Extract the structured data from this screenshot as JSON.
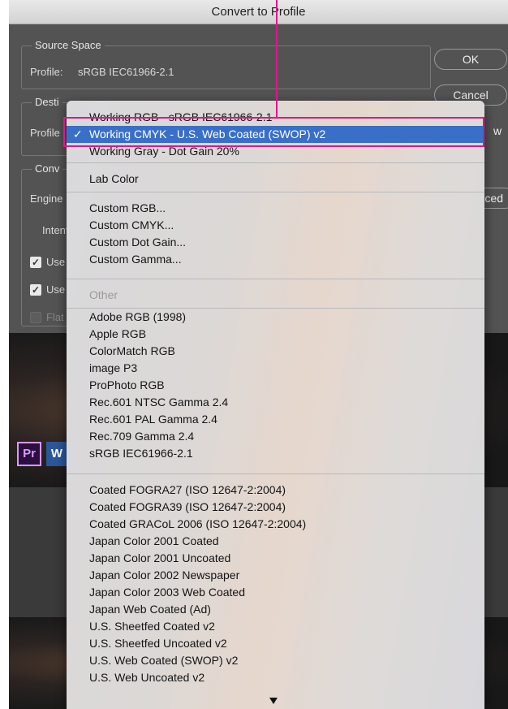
{
  "dialog": {
    "title": "Convert to Profile",
    "source": {
      "title": "Source Space",
      "profile_label": "Profile:",
      "profile_value": "sRGB IEC61966-2.1"
    },
    "destination": {
      "title": "Desti",
      "profile_label": "Profile"
    },
    "conversion": {
      "title": "Conv",
      "engine_label": "Engine",
      "intent_label": "Intent",
      "check1_label": "Use",
      "check2_label": "Use",
      "check3_label": "Flat",
      "check1_checked": true,
      "check2_checked": true,
      "check3_checked": false
    },
    "buttons": {
      "ok": "OK",
      "cancel": "Cancel",
      "preview_fragment": "w",
      "advanced_fragment": "ced"
    }
  },
  "background_apps": {
    "pr": "Pr",
    "w": "W"
  },
  "menu": {
    "selected_index": 1,
    "groups": [
      [
        "Working RGB - sRGB IEC61966-2.1",
        "Working CMYK - U.S. Web Coated (SWOP) v2",
        "Working Gray - Dot Gain 20%"
      ],
      [
        "Lab Color"
      ],
      [
        "Custom RGB...",
        "Custom CMYK...",
        "Custom Dot Gain...",
        "Custom Gamma..."
      ],
      [
        "Other"
      ],
      [
        "Adobe RGB (1998)",
        "Apple RGB",
        "ColorMatch RGB",
        "image P3",
        "ProPhoto RGB",
        "Rec.601 NTSC Gamma 2.4",
        "Rec.601 PAL Gamma 2.4",
        "Rec.709 Gamma 2.4",
        "sRGB IEC61966-2.1"
      ],
      [
        "Coated FOGRA27 (ISO 12647-2:2004)",
        "Coated FOGRA39 (ISO 12647-2:2004)",
        "Coated GRACoL 2006 (ISO 12647-2:2004)",
        "Japan Color 2001 Coated",
        "Japan Color 2001 Uncoated",
        "Japan Color 2002 Newspaper",
        "Japan Color 2003 Web Coated",
        "Japan Web Coated (Ad)",
        "U.S. Sheetfed Coated v2",
        "U.S. Sheetfed Uncoated v2",
        "U.S. Web Coated (SWOP) v2",
        "U.S. Web Uncoated v2"
      ]
    ],
    "check_mark": "✓",
    "scroll_icon": "triangle-down-icon"
  },
  "colors": {
    "highlight": "#3a6fc7",
    "annotation": "#e0168c"
  }
}
